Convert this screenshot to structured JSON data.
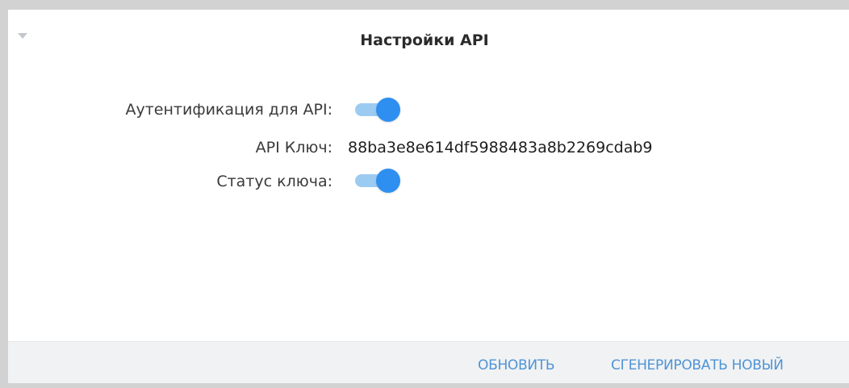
{
  "panel": {
    "title": "Настройки API"
  },
  "settings": {
    "auth_label": "Аутентификация для API:",
    "auth_enabled": true,
    "key_label": "API Ключ:",
    "key_value": "88ba3e8e614df5988483a8b2269cdab9",
    "status_label": "Статус ключа:",
    "status_enabled": true
  },
  "footer": {
    "refresh_label": "ОБНОВИТЬ",
    "generate_label": "СГЕНЕРИРОВАТЬ НОВЫЙ"
  },
  "colors": {
    "accent": "#2f8ff0",
    "toggle_track": "#9ccbf2",
    "link": "#4e94d6",
    "footer_bg": "#f1f2f3"
  },
  "icons": {
    "collapse": "chevron-down-icon"
  }
}
